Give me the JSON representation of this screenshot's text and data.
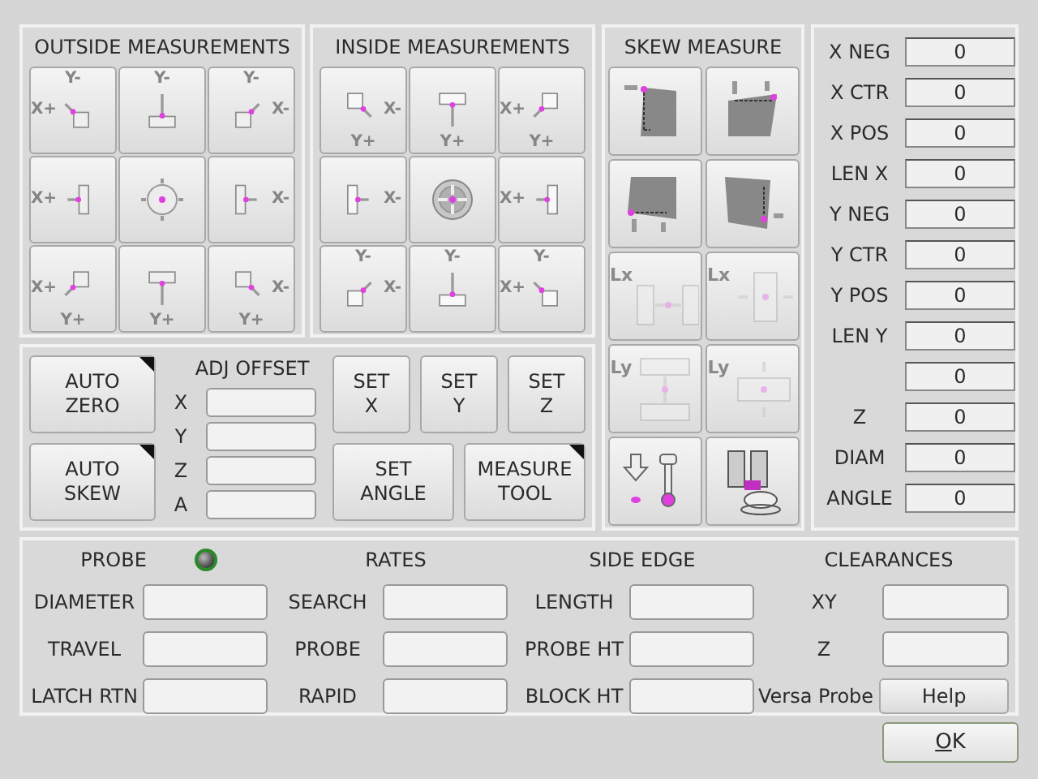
{
  "outside_measurements": {
    "title": "OUTSIDE MEASUREMENTS",
    "kind": "outside",
    "buttons": [
      {
        "kind": "br",
        "top": "Y-",
        "left": "X+"
      },
      {
        "kind": "b",
        "top": "Y-"
      },
      {
        "kind": "bl",
        "top": "Y-",
        "right": "X-"
      },
      {
        "kind": "r",
        "left": "X+"
      },
      {
        "kind": "c"
      },
      {
        "kind": "l",
        "right": "X-"
      },
      {
        "kind": "tr",
        "left": "X+",
        "bottom": "Y+"
      },
      {
        "kind": "t",
        "bottom": "Y+"
      },
      {
        "kind": "tl",
        "right": "X-",
        "bottom": "Y+"
      }
    ]
  },
  "inside_measurements": {
    "title": "INSIDE MEASUREMENTS",
    "kind": "inside",
    "buttons": [
      {
        "kind": "tl",
        "right": "X-",
        "bottom": "Y+"
      },
      {
        "kind": "t",
        "bottom": "Y+"
      },
      {
        "kind": "tr",
        "left": "X+",
        "bottom": "Y+"
      },
      {
        "kind": "l",
        "right": "X-"
      },
      {
        "kind": "c"
      },
      {
        "kind": "r",
        "left": "X+"
      },
      {
        "kind": "bl",
        "top": "Y-",
        "right": "X-"
      },
      {
        "kind": "b",
        "top": "Y-"
      },
      {
        "kind": "br",
        "top": "Y-",
        "left": "X+"
      }
    ]
  },
  "skew_measure": {
    "title": "SKEW MEASURE",
    "buttons": [
      {
        "kind": "skew-left",
        "disabled": false
      },
      {
        "kind": "skew-top",
        "disabled": false
      },
      {
        "kind": "skew-bottom",
        "disabled": false
      },
      {
        "kind": "skew-right",
        "disabled": false
      },
      {
        "kind": "length-x-outside",
        "label": "Lx",
        "disabled": true
      },
      {
        "kind": "length-x-inside",
        "label": "Lx",
        "disabled": true
      },
      {
        "kind": "length-y-outside",
        "label": "Ly",
        "disabled": true
      },
      {
        "kind": "length-y-inside",
        "label": "Ly",
        "disabled": true
      },
      {
        "kind": "probe-down",
        "disabled": false
      },
      {
        "kind": "tool-setter",
        "disabled": false
      }
    ]
  },
  "readouts": [
    {
      "label": "X NEG",
      "value": "0"
    },
    {
      "label": "X CTR",
      "value": "0"
    },
    {
      "label": "X POS",
      "value": "0"
    },
    {
      "label": "LEN X",
      "value": "0"
    },
    {
      "label": "Y NEG",
      "value": "0"
    },
    {
      "label": "Y CTR",
      "value": "0"
    },
    {
      "label": "Y POS",
      "value": "0"
    },
    {
      "label": "LEN Y",
      "value": "0"
    },
    {
      "value": "0"
    },
    {
      "label": "Z",
      "value": "0"
    },
    {
      "label": "DIAM",
      "value": "0"
    },
    {
      "label": "ANGLE",
      "value": "0"
    }
  ],
  "auto_buttons": [
    {
      "lines": [
        "AUTO",
        "ZERO"
      ],
      "has_menu": true
    },
    {
      "lines": [
        "AUTO",
        "SKEW"
      ],
      "has_menu": true
    }
  ],
  "adj_offset": {
    "title": "ADJ OFFSET",
    "fields": [
      {
        "label": "X"
      },
      {
        "label": "Y"
      },
      {
        "label": "Z"
      },
      {
        "label": "A"
      }
    ]
  },
  "set_buttons": [
    {
      "lines": [
        "SET",
        "X"
      ],
      "has_menu": false
    },
    {
      "lines": [
        "SET",
        "Y"
      ],
      "has_menu": false
    },
    {
      "lines": [
        "SET",
        "Z"
      ],
      "has_menu": false
    },
    {
      "lines": [
        "SET",
        "ANGLE"
      ],
      "has_menu": false
    },
    {
      "lines": [
        "MEASURE",
        "TOOL"
      ],
      "has_menu": true
    }
  ],
  "settings": [
    {
      "title": "PROBE",
      "led_on": false,
      "fields": [
        {
          "label": "DIAMETER"
        },
        {
          "label": "TRAVEL"
        },
        {
          "label": "LATCH RTN"
        }
      ]
    },
    {
      "title": "RATES",
      "fields": [
        {
          "label": "SEARCH"
        },
        {
          "label": "PROBE"
        },
        {
          "label": "RAPID"
        }
      ]
    },
    {
      "title": "SIDE EDGE",
      "fields": [
        {
          "label": "LENGTH"
        },
        {
          "label": "PROBE HT"
        },
        {
          "label": "BLOCK HT"
        }
      ]
    },
    {
      "title": "CLEARANCES",
      "fields": [
        {
          "label": "XY"
        },
        {
          "label": "Z"
        }
      ],
      "help": {
        "label": "Versa Probe",
        "button": "Help"
      }
    }
  ],
  "ok_button": {
    "label": "OK"
  }
}
